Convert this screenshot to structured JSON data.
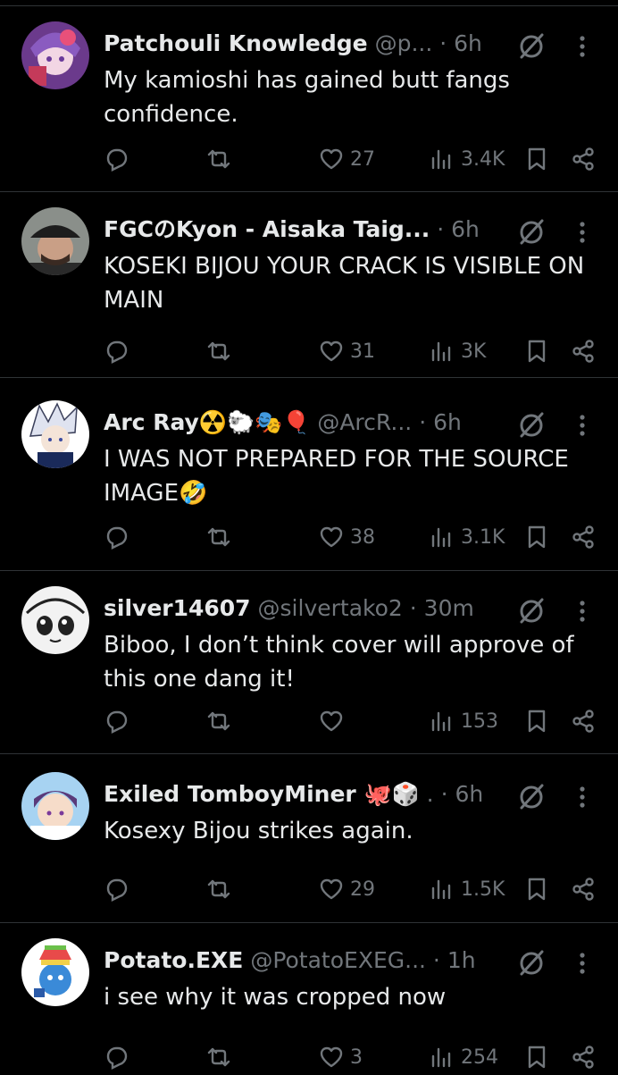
{
  "posts": [
    {
      "name": "Patchouli Knowledge",
      "handle": "@p...",
      "time": "6h",
      "text": "My kamioshi has gained butt fangs confidence.",
      "replies": "",
      "reposts": "",
      "likes": "27",
      "views": "3.4K",
      "avatar": "patchouli-avatar"
    },
    {
      "name": "FGCのKyon - Aisaka Taig...",
      "handle": "",
      "time": "6h",
      "text": "KOSEKI BIJOU YOUR CRACK IS VISIBLE ON MAIN",
      "replies": "",
      "reposts": "",
      "likes": "31",
      "views": "3K",
      "avatar": "kyon-avatar"
    },
    {
      "name": "Arc Ray☢️🐑🎭🎈",
      "handle": "@ArcR...",
      "time": "6h",
      "text": "I WAS NOT PREPARED FOR THE SOURCE IMAGE🤣",
      "replies": "",
      "reposts": "",
      "likes": "38",
      "views": "3.1K",
      "avatar": "arcray-avatar"
    },
    {
      "name": "silver14607",
      "handle": "@silvertako2",
      "time": "30m",
      "text": "Biboo, I don’t think cover will approve of this one dang it!",
      "replies": "",
      "reposts": "",
      "likes": "",
      "views": "153",
      "avatar": "silver-avatar"
    },
    {
      "name": "Exiled TomboyMiner 🐙🎲",
      "handle": ".",
      "time": "6h",
      "text": "Kosexy Bijou strikes again.",
      "replies": "",
      "reposts": "",
      "likes": "29",
      "views": "1.5K",
      "avatar": "tomboy-avatar"
    },
    {
      "name": "Potato.EXE",
      "handle": "@PotatoEXEG...",
      "time": "1h",
      "text": "i see why it was cropped now",
      "replies": "",
      "reposts": "",
      "likes": "3",
      "views": "254",
      "avatar": "potato-avatar"
    }
  ],
  "icons": {
    "reply": "reply-icon",
    "repost": "repost-icon",
    "like": "heart-icon",
    "views": "views-icon",
    "bookmark": "bookmark-icon",
    "share": "share-icon",
    "grok": "grok-icon",
    "more": "more-icon"
  },
  "colors": {
    "background": "#000000",
    "text": "#e7e9ea",
    "muted": "#71767b",
    "divider": "#2f3336"
  }
}
